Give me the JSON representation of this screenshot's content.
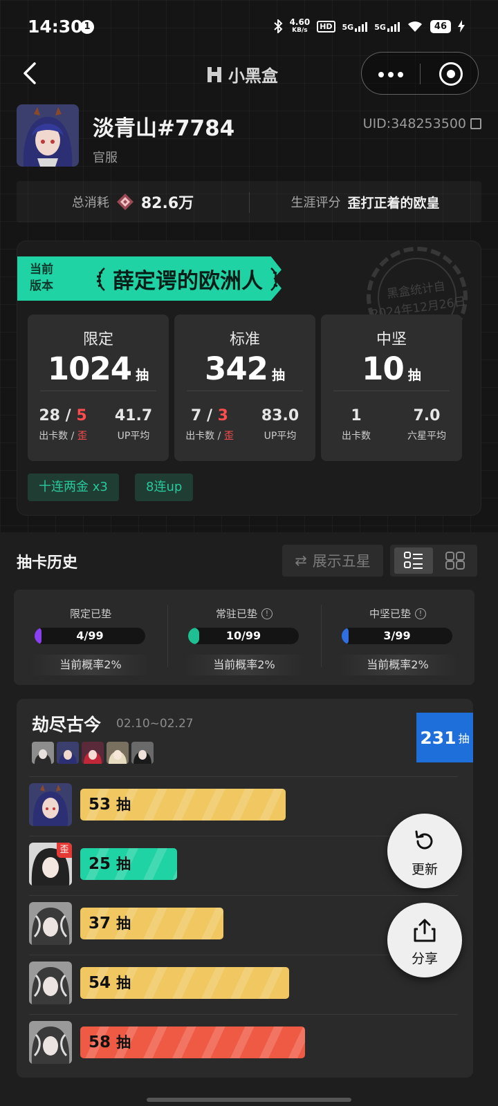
{
  "status_bar": {
    "time": "14:30",
    "notif_count": "1",
    "speed_top": "4.60",
    "speed_unit": "KB/s",
    "hd": "HD",
    "net1": "5G",
    "net2": "5G",
    "battery": "46"
  },
  "nav": {
    "title": "小黑盒"
  },
  "profile": {
    "username": "淡青山#7784",
    "server": "官服",
    "uid": "UID:348253500",
    "total_spend_label": "总消耗",
    "total_spend_value": "82.6万",
    "career_label": "生涯评分",
    "career_value": "歪打正着的欧皇"
  },
  "version_card": {
    "ribbon_tag_1": "当前",
    "ribbon_tag_2": "版本",
    "title": "薛定谔的欧洲人",
    "stamp_1": "黑盒统计自",
    "stamp_2": "2024年12月26日",
    "pools": [
      {
        "name": "限定",
        "count": "1024",
        "unit": "抽",
        "m1_a": "28",
        "m1_sep": " / ",
        "m1_b": "5",
        "m1_l1": "出卡数 / ",
        "m1_l2": "歪",
        "m2_v": "41.7",
        "m2_l": "UP平均"
      },
      {
        "name": "标准",
        "count": "342",
        "unit": "抽",
        "m1_a": "7",
        "m1_sep": " / ",
        "m1_b": "3",
        "m1_l1": "出卡数 / ",
        "m1_l2": "歪",
        "m2_v": "83.0",
        "m2_l": "UP平均"
      },
      {
        "name": "中坚",
        "count": "10",
        "unit": "抽",
        "m1_a": "1",
        "m1_l1": "出卡数",
        "m2_v": "7.0",
        "m2_l": "六星平均"
      }
    ],
    "tags": [
      "十连两金  x3",
      "8连up"
    ]
  },
  "history": {
    "title": "抽卡历史",
    "show_five_star": "展示五星",
    "pity": [
      {
        "label": "限定已垫",
        "value": "4/99",
        "fraction": 0.04,
        "color": "#8a3ff0",
        "rate": "当前概率2%"
      },
      {
        "label": "常驻已垫",
        "value": "10/99",
        "fraction": 0.1,
        "color": "#1fbf94",
        "rate": "当前概率2%"
      },
      {
        "label": "中坚已垫",
        "value": "3/99",
        "fraction": 0.03,
        "color": "#2f6fe0",
        "rate": "当前概率2%"
      }
    ],
    "banner": {
      "name": "劫尽古今",
      "dates": "02.10~02.27",
      "total": "231",
      "total_unit": "抽",
      "rows": [
        {
          "count": "53",
          "unit": "抽",
          "color": "#f0c761",
          "fraction": 0.53,
          "wai": false
        },
        {
          "count": "25",
          "unit": "抽",
          "color": "#1fd3a4",
          "fraction": 0.25,
          "wai": true,
          "wai_label": "歪"
        },
        {
          "count": "37",
          "unit": "抽",
          "color": "#f0c761",
          "fraction": 0.37,
          "wai": false
        },
        {
          "count": "54",
          "unit": "抽",
          "color": "#f0c761",
          "fraction": 0.54,
          "wai": false
        },
        {
          "count": "58",
          "unit": "抽",
          "color": "#ef5a45",
          "fraction": 0.58,
          "wai": false
        }
      ]
    }
  },
  "fab": {
    "refresh": "更新",
    "share": "分享"
  }
}
